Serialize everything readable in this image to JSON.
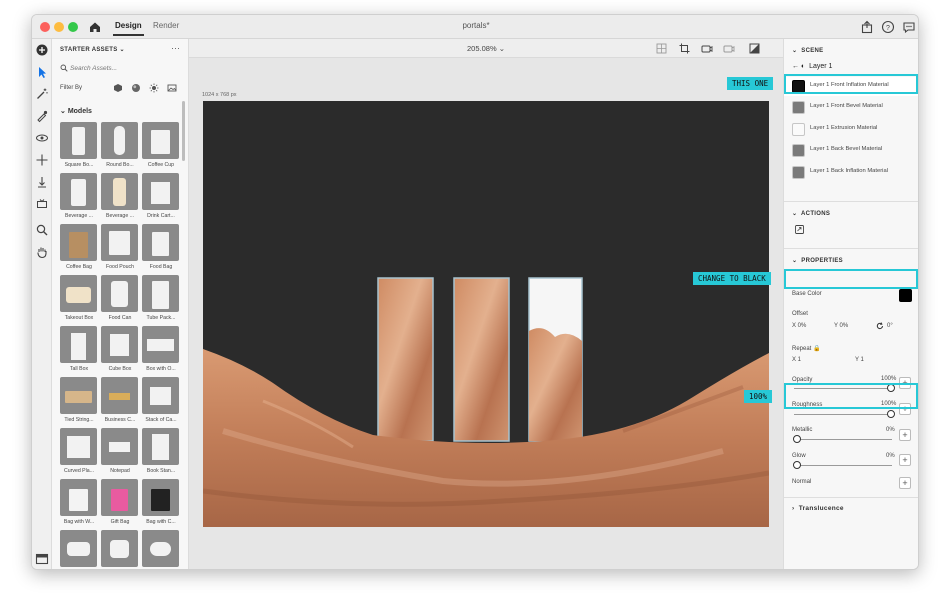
{
  "titlebar": {
    "tab_design": "Design",
    "tab_render": "Render",
    "document_title": "portals*"
  },
  "assets": {
    "title": "STARTER ASSETS ⌄",
    "more": "···",
    "search_placeholder": "Search Assets...",
    "filter_label": "Filter By",
    "models_heading": "Models",
    "items": [
      "Square Bo...",
      "Round Bo...",
      "Coffee Cup",
      "Beverage ...",
      "Beverage ...",
      "Drink Cart...",
      "Coffee Bag",
      "Food Pouch",
      "Food Bag",
      "Takeout Box",
      "Food Can",
      "Tube Pack...",
      "Tall Box",
      "Cube Box",
      "Box with O...",
      "Tied String...",
      "Business C...",
      "Stack of Ca...",
      "Curved Pla...",
      "Notepad",
      "Book Stan...",
      "Bag with W...",
      "Gift Bag",
      "Bag with C...",
      "Small Jar...",
      "Twist Jar",
      "Twist Cap..."
    ]
  },
  "viewport": {
    "zoom": "205.08% ⌄",
    "canvas_size": "1024 x 768 px"
  },
  "scene": {
    "heading": "SCENE",
    "layer": "Layer 1",
    "materials": [
      "Layer 1 Front Inflation Material",
      "Layer 1 Front Bevel Material",
      "Layer 1 Extrusion Material",
      "Layer 1 Back Bevel Material",
      "Layer 1 Back Inflation Material"
    ],
    "actions_heading": "ACTIONS",
    "properties_heading": "PROPERTIES",
    "base_color_label": "Base Color",
    "offset_label": "Offset",
    "offset_x": "X  0%",
    "offset_y": "Y  0%",
    "offset_rot": "0°",
    "repeat_label": "Repeat",
    "repeat_x": "X  1",
    "repeat_y": "Y  1",
    "opacity_label": "Opacity",
    "opacity_val": "100%",
    "roughness_label": "Roughness",
    "roughness_val": "100%",
    "metallic_label": "Metallic",
    "metallic_val": "0%",
    "glow_label": "Glow",
    "glow_val": "0%",
    "normal_label": "Normal",
    "translucence_label": "Translucence"
  },
  "callouts": {
    "this_one": "THIS ONE",
    "change_to_black": "CHANGE TO BLACK",
    "hundred": "100%"
  },
  "colors": {
    "accent_cyan": "#27c8d6",
    "canvas_bg": "#2b2b2b",
    "terrain": "#c98a64"
  }
}
